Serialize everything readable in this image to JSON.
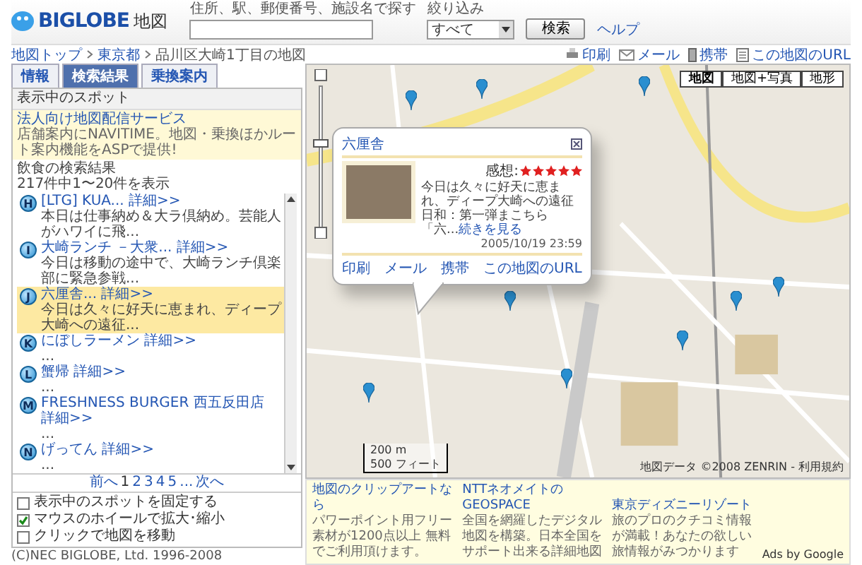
{
  "header": {
    "logo_text": "BIGLOBE",
    "section": "地図",
    "search_label": "住所、駅、郵便番号、施設名で探す",
    "filter_label": "絞り込み",
    "filter_value": "すべて",
    "search_button": "検索",
    "help": "ヘルプ"
  },
  "breadcrumb": [
    "地図トップ",
    "東京都",
    "品川区大崎1丁目の地図"
  ],
  "tools": [
    {
      "kind": "print",
      "label": "印刷"
    },
    {
      "kind": "mail",
      "label": "メール"
    },
    {
      "kind": "mobile",
      "label": "携帯"
    },
    {
      "kind": "url",
      "label": "この地図のURL"
    }
  ],
  "tabs": [
    {
      "label": "情報",
      "selected": false
    },
    {
      "label": "検索結果",
      "selected": true
    },
    {
      "label": "乗換案内",
      "selected": false
    }
  ],
  "sidebar": {
    "heading": "表示中のスポット",
    "promo": {
      "title": "法人向け地図配信サービス",
      "body": "店舗案内にNAVITIME。地図・乗換ほかルート案内機能をASPで提供!"
    },
    "results_label": "飲食の検索結果",
    "count": "217件中1〜20件を表示",
    "spots": [
      {
        "marker": "H",
        "title": "[LTG] KUA...",
        "more": "詳細>>",
        "desc": "本日は仕事納め＆大ラ倶納め。芸能人がハワイに飛...",
        "selected": false
      },
      {
        "marker": "I",
        "title": "大崎ランチ －大衆...",
        "more": "詳細>>",
        "desc": "今日は移動の途中で、大崎ランチ倶楽部に緊急参戦...",
        "selected": false
      },
      {
        "marker": "J",
        "title": "六厘舎...",
        "more": "詳細>>",
        "desc": "今日は久々に好天に恵まれ、ディープ大崎への遠征...",
        "selected": true
      },
      {
        "marker": "K",
        "title": "にぼしラーメン",
        "more": "詳細>>",
        "desc": "...",
        "selected": false
      },
      {
        "marker": "L",
        "title": "蟹帰",
        "more": "詳細>>",
        "desc": "...",
        "selected": false
      },
      {
        "marker": "M",
        "title": "FRESHNESS BURGER 西五反田店",
        "more": "詳細>>",
        "desc": "...",
        "selected": false
      },
      {
        "marker": "N",
        "title": "げってん",
        "more": "詳細>>",
        "desc": "...",
        "selected": false
      }
    ],
    "pager": {
      "prev": "前へ",
      "pages": [
        {
          "label": "1",
          "selected": true
        },
        {
          "label": "2",
          "selected": false
        },
        {
          "label": "3",
          "selected": false
        },
        {
          "label": "4",
          "selected": false
        },
        {
          "label": "5",
          "selected": false
        }
      ],
      "ellipsis": "...",
      "next": "次へ"
    },
    "options": [
      {
        "label": "表示中のスポットを固定する",
        "checked": false
      },
      {
        "label": "マウスのホイールで拡大･縮小",
        "checked": true
      },
      {
        "label": "クリックで地図を移動",
        "checked": false
      }
    ],
    "copyright": "(C)NEC BIGLOBE, Ltd. 1996-2008"
  },
  "map": {
    "map_types": [
      {
        "label": "地図",
        "selected": true
      },
      {
        "label": "地図+写真",
        "selected": false
      },
      {
        "label": "地形",
        "selected": false
      }
    ],
    "popup": {
      "title": "六厘舎",
      "rating_label": "感想:",
      "stars": 5,
      "text": "今日は久々に好天に恵まれ、ディープ大崎への遠征日和：第一弾まこちら「六...",
      "more": "続きを見る",
      "date": "2005/10/19 23:59",
      "links": [
        "印刷",
        "メール",
        "携帯",
        "この地図のURL"
      ]
    },
    "scale": [
      "200 m",
      "500 フィート"
    ],
    "attribution": "地図データ ©2008 ZENRIN - 利用規約"
  },
  "ads": {
    "items": [
      {
        "title": "地図のクリップアートなら",
        "body": "パワーポイント用フリー素材が1200点以上 無料でご利用頂けます。"
      },
      {
        "title": "NTTネオメイトのGEOSPACE",
        "body": "全国を網羅したデジタル地図を構築。日本全国をサポート出来る詳細地図"
      },
      {
        "title": "東京ディズニーリゾート",
        "body": "旅のプロのクチコミ情報が満載！あなたの欲しい旅情報がみつかります"
      }
    ],
    "credit": "Ads by Google"
  }
}
